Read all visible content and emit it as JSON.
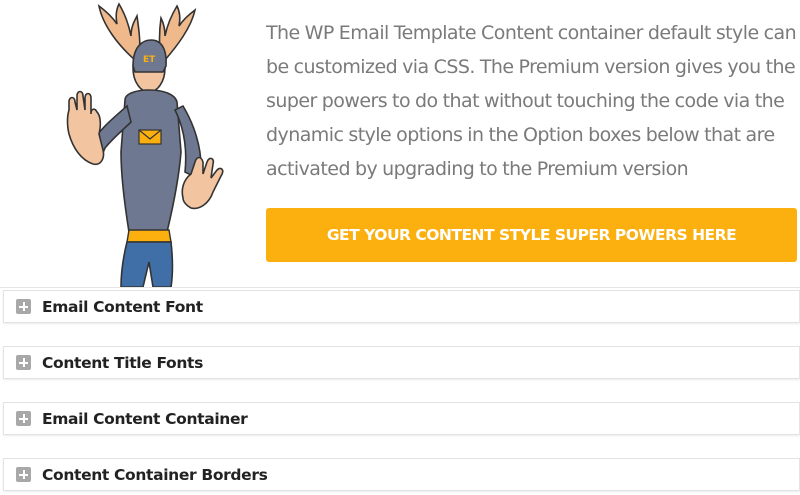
{
  "promo": {
    "lines": [
      "The WP Email Template Content container default style can",
      "be customized via CSS. The Premium version gives you the",
      "super powers to do that without touching the code via the",
      "dynamic style options in the Option boxes below that are",
      "activated by upgrading to the Premium version"
    ],
    "cta_label": "GET YOUR CONTENT STYLE SUPER POWERS HERE",
    "mascot_badge": "ET",
    "colors": {
      "cta_background": "#fbb010",
      "text": "#7a7a7a"
    }
  },
  "panels": [
    {
      "title": "Email Content Font",
      "icon": "plus-square-icon"
    },
    {
      "title": "Content Title Fonts",
      "icon": "plus-square-icon"
    },
    {
      "title": "Email Content Container",
      "icon": "plus-square-icon"
    },
    {
      "title": "Content Container Borders",
      "icon": "plus-square-icon"
    }
  ]
}
